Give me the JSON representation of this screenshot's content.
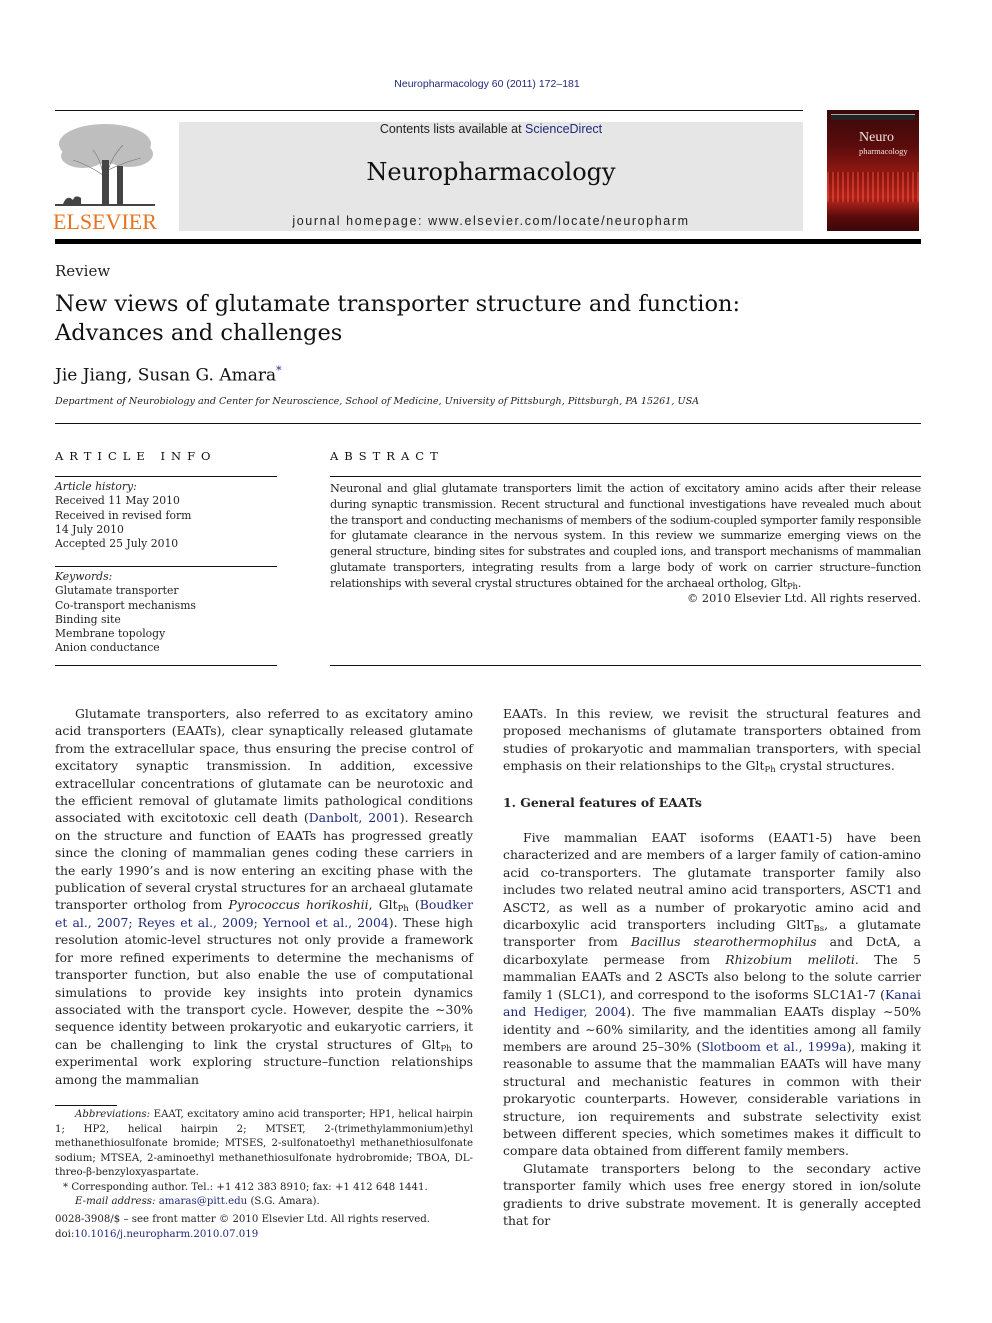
{
  "header": {
    "citation": "Neuropharmacology 60 (2011) 172–181",
    "contents_prefix": "Contents lists available at ",
    "contents_link": "ScienceDirect",
    "journal_title": "Neuropharmacology",
    "homepage": "journal homepage: www.elsevier.com/locate/neuropharm",
    "publisher_logo_text": "ELSEVIER",
    "cover_title_line1": "Neuro",
    "cover_title_line2": "pharmacology"
  },
  "article": {
    "type": "Review",
    "title": "New views of glutamate transporter structure and function: Advances and challenges",
    "authors": "Jie Jiang, Susan G. Amara",
    "author_mark": "*",
    "affiliation": "Department of Neurobiology and Center for Neuroscience, School of Medicine, University of Pittsburgh, Pittsburgh, PA 15261, USA"
  },
  "article_info": {
    "heading": "ARTICLE INFO",
    "history_label": "Article history:",
    "history": [
      "Received 11 May 2010",
      "Received in revised form",
      "14 July 2010",
      "Accepted 25 July 2010"
    ],
    "keywords_label": "Keywords:",
    "keywords": [
      "Glutamate transporter",
      "Co-transport mechanisms",
      "Binding site",
      "Membrane topology",
      "Anion conductance"
    ]
  },
  "abstract": {
    "heading": "ABSTRACT",
    "text_main": "Neuronal and glial glutamate transporters limit the action of excitatory amino acids after their release during synaptic transmission. Recent structural and functional investigations have revealed much about the transport and conducting mechanisms of members of the sodium-coupled symporter family responsible for glutamate clearance in the nervous system. In this review we summarize emerging views on the general structure, binding sites for substrates and coupled ions, and transport mechanisms of mammalian glutamate transporters, integrating results from a large body of work on carrier structure–function relationships with several crystal structures obtained for the archaeal ortholog, Glt",
    "text_sub": "Ph",
    "text_end": ".",
    "copyright": "© 2010 Elsevier Ltd. All rights reserved."
  },
  "body": {
    "left_p1": {
      "a": "Glutamate transporters, also referred to as excitatory amino acid transporters (EAATs), clear synaptically released glutamate from the extracellular space, thus ensuring the precise control of excitatory synaptic transmission. In addition, excessive extracellular concentrations of glutamate can be neurotoxic and the efficient removal of glutamate limits pathological conditions associated with excitotoxic cell death (",
      "ref1": "Danbolt, 2001",
      "b": "). Research on the structure and function of EAATs has progressed greatly since the cloning of mammalian genes coding these carriers in the early 1990’s and is now entering an exciting phase with the publication of several crystal structures for an archaeal glutamate transporter ortholog from ",
      "species": "Pyrococcus horikoshii",
      "c": ", Glt",
      "sub1": "Ph",
      "d": " (",
      "ref2": "Boudker et al., 2007; Reyes et al., 2009; Yernool et al., 2004",
      "e": "). These high resolution atomic-level structures not only provide a framework for more refined experiments to determine the mechanisms of transporter function, but also enable the use of computational simulations to provide key insights into protein dynamics associated with the transport cycle. However, despite the ∼30% sequence identity between prokaryotic and eukaryotic carriers, it can be challenging to link the crystal structures of Glt",
      "sub2": "Ph",
      "f": " to experimental work exploring structure–function relationships among the mammalian"
    },
    "right_p1": {
      "a": "EAATs. In this review, we revisit the structural features and proposed mechanisms of glutamate transporters obtained from studies of prokaryotic and mammalian transporters, with special emphasis on their relationships to the Glt",
      "sub": "Ph",
      "b": " crystal structures."
    },
    "section1_heading": "1.  General features of EAATs",
    "right_p2": {
      "a": "Five mammalian EAAT isoforms (EAAT1-5) have been characterized and are members of a larger family of cation-amino acid co-transporters. The glutamate transporter family also includes two related neutral amino acid transporters, ASCT1 and ASCT2, as well as a number of prokaryotic amino acid and dicarboxylic acid transporters including GltT",
      "sub": "Bs",
      "b": ", a glutamate transporter from ",
      "species1": "Bacillus stearothermophilus",
      "c": " and DctA, a dicarboxylate permease from ",
      "species2": "Rhizobium meliloti",
      "d": ". The 5 mammalian EAATs and 2 ASCTs also belong to the solute carrier family 1 (SLC1), and correspond to the isoforms SLC1A1-7 (",
      "ref1": "Kanai and Hediger, 2004",
      "e": "). The five mammalian EAATs display ∼50% identity and ∼60% similarity, and the identities among all family members are around 25–30% (",
      "ref2": "Slotboom et al., 1999a",
      "f": "), making it reasonable to assume that the mammalian EAATs will have many structural and mechanistic features in common with their prokaryotic counterparts. However, considerable variations in structure, ion requirements and substrate selectivity exist between different species, which sometimes makes it difficult to compare data obtained from different family members."
    },
    "right_p3": "Glutamate transporters belong to the secondary active transporter family which uses free energy stored in ion/solute gradients to drive substrate movement. It is generally accepted that for"
  },
  "footnotes": {
    "abbrev_label": "Abbreviations:",
    "abbrev_text": " EAAT, excitatory amino acid transporter; HP1, helical hairpin 1; HP2, helical hairpin 2; MTSET, 2-(trimethylammonium)ethyl methanethiosulfonate bromide; MTSES, 2-sulfonatoethyl methanethiosulfonate sodium; MTSEA, 2-aminoethyl methanethiosulfonate hydrobromide; TBOA, DL-threo-β-benzyloxyaspartate.",
    "corresponding": "* Corresponding author. Tel.: +1 412 383 8910; fax: +1 412 648 1441.",
    "email_label": "E-mail address:",
    "email": "amaras@pitt.edu",
    "email_suffix": " (S.G. Amara).",
    "frontmatter": "0028-3908/$ – see front matter © 2010 Elsevier Ltd. All rights reserved.",
    "doi_prefix": "doi:",
    "doi": "10.1016/j.neuropharm.2010.07.019"
  },
  "colors": {
    "link": "#1f2a7a",
    "elsevier_orange": "#e7741f",
    "banner_gray": "#e6e6e6"
  }
}
